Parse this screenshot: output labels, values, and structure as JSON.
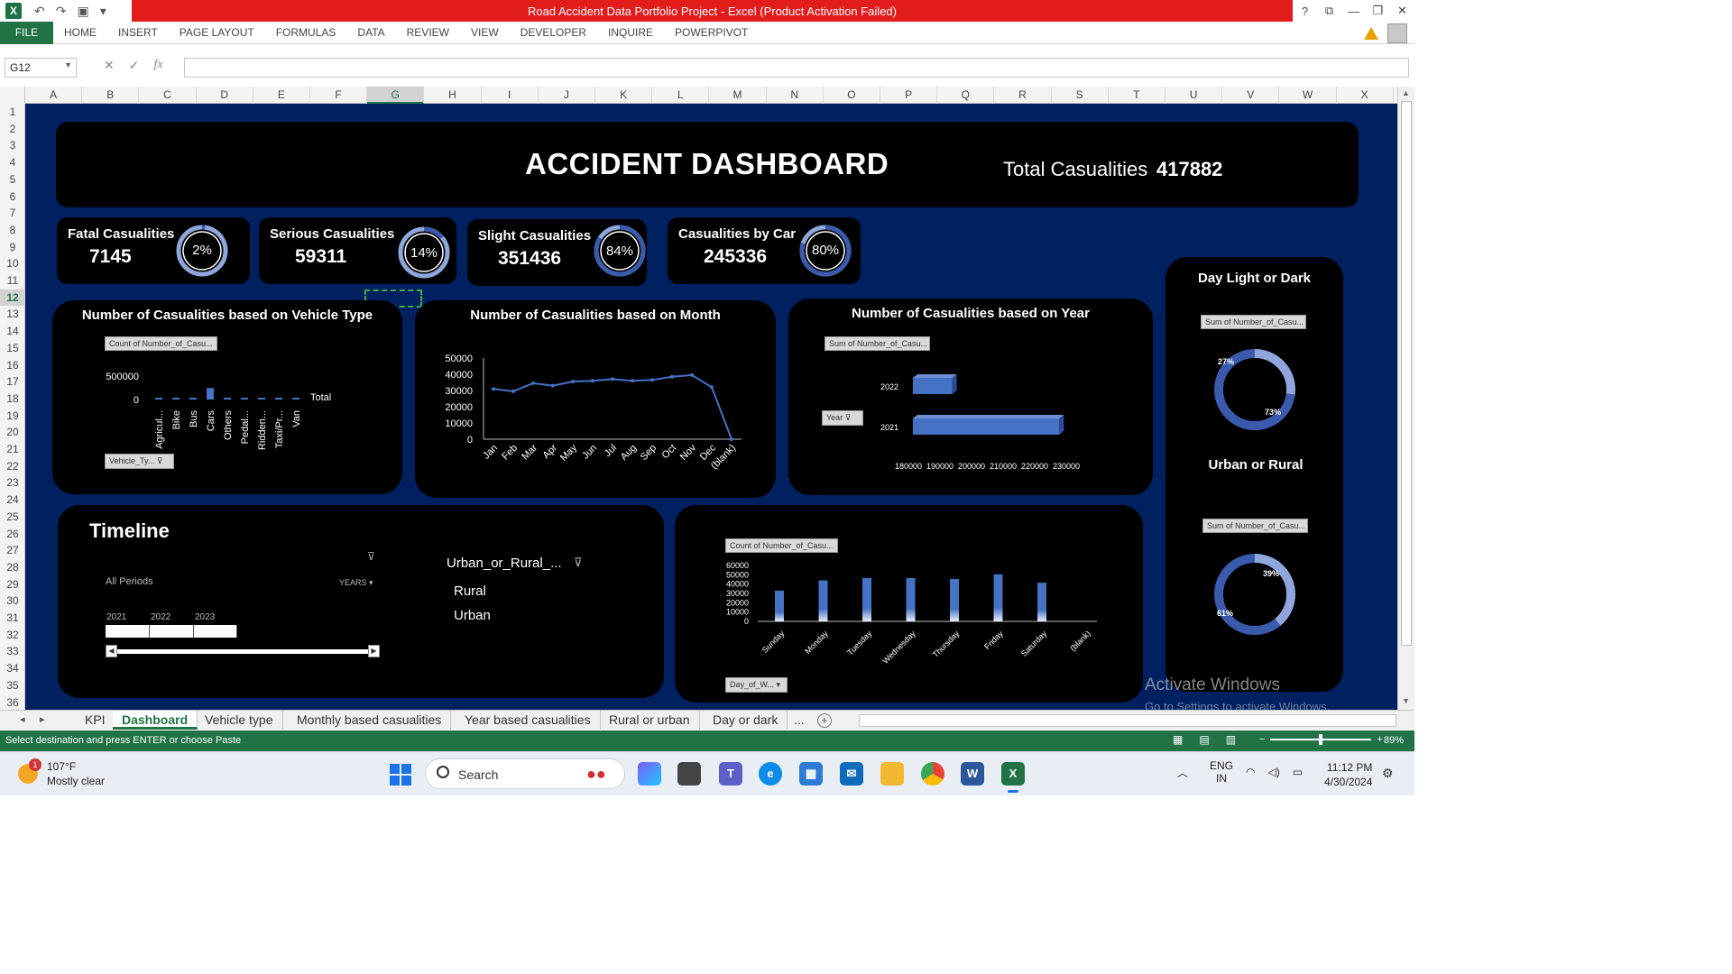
{
  "window": {
    "title": "Road Accident Data Portfolio Project -  Excel (Product Activation Failed)",
    "help": "?",
    "controls": [
      "⧉",
      "—",
      "❐",
      "✕"
    ]
  },
  "ribbon": {
    "tabs": [
      "FILE",
      "HOME",
      "INSERT",
      "PAGE LAYOUT",
      "FORMULAS",
      "DATA",
      "REVIEW",
      "VIEW",
      "DEVELOPER",
      "INQUIRE",
      "POWERPIVOT"
    ]
  },
  "formula_bar": {
    "name_box": "G12",
    "fx": "fx",
    "value": ""
  },
  "grid": {
    "columns": [
      "A",
      "B",
      "C",
      "D",
      "E",
      "F",
      "G",
      "H",
      "I",
      "J",
      "K",
      "L",
      "M",
      "N",
      "O",
      "P",
      "Q",
      "R",
      "S",
      "T",
      "U",
      "V",
      "W",
      "X"
    ],
    "selected_column": "G",
    "rows": [
      "1",
      "2",
      "3",
      "4",
      "5",
      "6",
      "7",
      "8",
      "9",
      "10",
      "11",
      "12",
      "13",
      "14",
      "15",
      "16",
      "17",
      "18",
      "19",
      "20",
      "21",
      "22",
      "23",
      "24",
      "25",
      "26",
      "27",
      "28",
      "29",
      "30",
      "31",
      "32",
      "33",
      "34",
      "35",
      "36"
    ],
    "selected_row": "12"
  },
  "header": {
    "title": "ACCIDENT DASHBOARD",
    "total_label": "Total Casualities",
    "total_value": "417882"
  },
  "kpis": [
    {
      "label": "Fatal Casualities",
      "value": "7145",
      "pct_text": "2%",
      "pct": 0.02
    },
    {
      "label": "Serious Casualities",
      "value": "59311",
      "pct_text": "14%",
      "pct": 0.14
    },
    {
      "label": "Slight Casualities",
      "value": "351436",
      "pct_text": "84%",
      "pct": 0.84
    },
    {
      "label": "Casualities by Car",
      "value": "245336",
      "pct_text": "80%",
      "pct": 0.8
    }
  ],
  "vehicle_panel": {
    "title": "Number of Casualities based on Vehicle Type",
    "field_button": "Count of Number_of_Casu...",
    "filter_button": "Vehicle_Ty...",
    "legend": "Total"
  },
  "month_panel": {
    "title": "Number of Casualities based on Month"
  },
  "year_panel": {
    "title": "Number of Casualities based on Year",
    "field_button": "Sum of Number_of_Casu...",
    "filter_button": "Year"
  },
  "day_dark_panel": {
    "title": "Day Light or Dark",
    "field_button": "Sum of Number_of_Casu..."
  },
  "urban_rural_panel": {
    "title": "Urban or Rural",
    "field_button": "Sum of Number_of_Casu..."
  },
  "timeline": {
    "title": "Timeline",
    "all_periods": "All Periods",
    "level": "YEARS",
    "years": [
      "2021",
      "2022",
      "2023"
    ]
  },
  "slicer": {
    "title": "Urban_or_Rural_...",
    "items": [
      "Rural",
      "Urban"
    ]
  },
  "weekday_panel": {
    "field_button": "Count of Number_of_Casu...",
    "filter_button": "Day_of_W..."
  },
  "chart_data": [
    {
      "type": "bar",
      "title": "Number of Casualities based on Vehicle Type",
      "categories": [
        "Agricul...",
        "Bike",
        "Bus",
        "Cars",
        "Others",
        "Pedal...",
        "Ridden...",
        "Taxi/Pr...",
        "Van"
      ],
      "series": [
        {
          "name": "Total",
          "values": [
            2000,
            15000,
            12000,
            245336,
            4000,
            6000,
            3000,
            20000,
            18000
          ]
        }
      ],
      "yticks": [
        "500000",
        "0"
      ],
      "ylim": [
        0,
        500000
      ],
      "legend": "right"
    },
    {
      "type": "line",
      "title": "Number of Casualities based on Month",
      "categories": [
        "Jan",
        "Feb",
        "Mar",
        "Apr",
        "May",
        "Jun",
        "Jul",
        "Aug",
        "Sep",
        "Oct",
        "Nov",
        "Dec",
        "(blank)"
      ],
      "values": [
        31000,
        29500,
        34500,
        33000,
        35500,
        36000,
        37000,
        36000,
        36500,
        38500,
        39500,
        32000,
        0
      ],
      "yticks": [
        "50000",
        "40000",
        "30000",
        "20000",
        "10000",
        "0"
      ],
      "ylim": [
        0,
        50000
      ],
      "grid": false
    },
    {
      "type": "bar",
      "title": "Number of Casualities based on Year",
      "orientation": "horizontal",
      "categories": [
        "2022",
        "2021"
      ],
      "values": [
        195000,
        223000
      ],
      "xticks": [
        "180000",
        "190000",
        "200000",
        "210000",
        "220000",
        "230000"
      ],
      "xlim": [
        180000,
        230000
      ]
    },
    {
      "type": "pie",
      "title": "Day Light or Dark",
      "labels": [
        "27%",
        "73%"
      ],
      "values": [
        27,
        73
      ],
      "colors": [
        "#8fa6dc",
        "#3a5aad"
      ]
    },
    {
      "type": "pie",
      "title": "Urban or Rural",
      "labels": [
        "39%",
        "61%"
      ],
      "values": [
        39,
        61
      ],
      "colors": [
        "#8fa6dc",
        "#3a5aad"
      ]
    },
    {
      "type": "bar",
      "categories": [
        "Sunday",
        "Monday",
        "Tuesday",
        "Wednesday",
        "Thursday",
        "Friday",
        "Saturday",
        "(blank)"
      ],
      "values": [
        33000,
        44000,
        46500,
        46500,
        45500,
        50500,
        41500,
        0
      ],
      "yticks": [
        "60000",
        "50000",
        "40000",
        "30000",
        "20000",
        "10000",
        "0"
      ],
      "ylim": [
        0,
        60000
      ]
    }
  ],
  "watermark": {
    "line1": "Activate Windows",
    "line2": "Go to Settings to activate Windows."
  },
  "sheet_tabs": {
    "tabs": [
      "KPI",
      "Dashboard",
      "Vehicle type",
      "Monthly based casualities",
      "Year based casualities",
      "Rural or urban",
      "Day or dark",
      "..."
    ],
    "active": "Dashboard"
  },
  "status_bar": {
    "message": "Select destination and press ENTER or choose Paste",
    "zoom": "89%"
  },
  "taskbar": {
    "badge": "1",
    "temperature": "107°F",
    "weather": "Mostly clear",
    "search": "Search",
    "language_1": "ENG",
    "language_2": "IN",
    "time": "11:12 PM",
    "date": "4/30/2024"
  },
  "colors": {
    "excel_green": "#217346",
    "title_red": "#e21b1b",
    "dashboard_bg": "#002060",
    "panel_bg": "#000000",
    "series_blue": "#4472c4"
  }
}
